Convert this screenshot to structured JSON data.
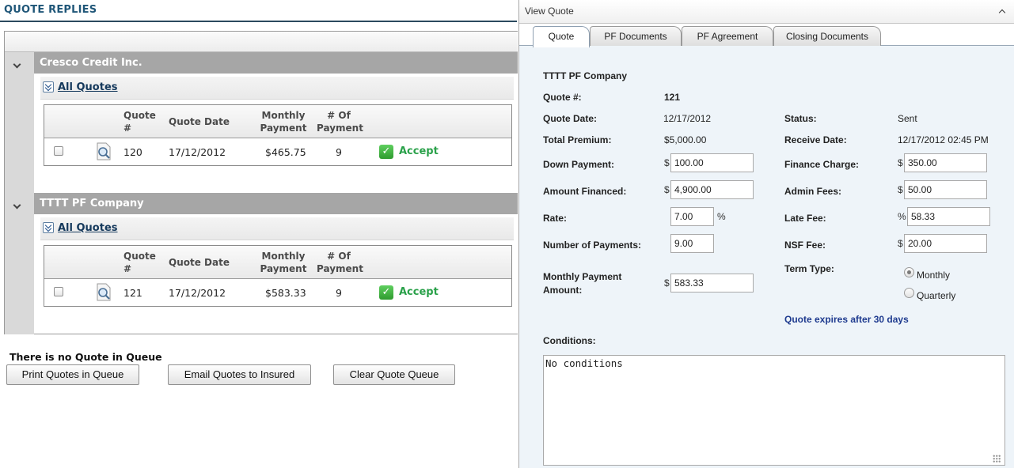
{
  "left": {
    "title": "QUOTE REPLIES",
    "companies": [
      {
        "name": "Cresco Credit Inc.",
        "all_quotes": "All Quotes",
        "headers": {
          "quote_num": "Quote #",
          "quote_date": "Quote Date",
          "monthly_payment": "Monthly Payment",
          "num_payment": "# Of Payment"
        },
        "rows": [
          {
            "quote": "120",
            "date": "17/12/2012",
            "payment": "$465.75",
            "count": "9",
            "action": "Accept"
          }
        ]
      },
      {
        "name": "TTTT PF Company",
        "all_quotes": "All Quotes",
        "headers": {
          "quote_num": "Quote #",
          "quote_date": "Quote Date",
          "monthly_payment": "Monthly Payment",
          "num_payment": "# Of Payment"
        },
        "rows": [
          {
            "quote": "121",
            "date": "17/12/2012",
            "payment": "$583.33",
            "count": "9",
            "action": "Accept"
          }
        ]
      }
    ],
    "queue_message": "There is no Quote in Queue",
    "buttons": {
      "print": "Print Quotes in Queue",
      "email": "Email Quotes to Insured",
      "clear": "Clear Quote Queue"
    }
  },
  "right": {
    "title": "View Quote",
    "tabs": [
      "Quote",
      "PF Documents",
      "PF Agreement",
      "Closing Documents"
    ],
    "company": "TTTT PF Company",
    "quote_num_label": "Quote #:",
    "quote_num": "121",
    "quote_date_label": "Quote Date:",
    "quote_date": "12/17/2012",
    "status_label": "Status:",
    "status": "Sent",
    "total_premium_label": "Total Premium:",
    "total_premium": "$5,000.00",
    "receive_date_label": "Receive Date:",
    "receive_date": "12/17/2012 02:45 PM",
    "down_payment_label": "Down Payment:",
    "down_payment": "100.00",
    "finance_charge_label": "Finance Charge:",
    "finance_charge": "350.00",
    "amount_financed_label": "Amount Financed:",
    "amount_financed": "4,900.00",
    "admin_fees_label": "Admin Fees:",
    "admin_fees": "50.00",
    "rate_label": "Rate:",
    "rate": "7.00",
    "late_fee_label": "Late Fee:",
    "late_fee": "58.33",
    "num_payments_label": "Number of Payments:",
    "num_payments": "9.00",
    "nsf_fee_label": "NSF Fee:",
    "nsf_fee": "20.00",
    "monthly_payment_label_1": "Monthly Payment",
    "monthly_payment_label_2": "Amount:",
    "monthly_payment": "583.33",
    "term_type_label": "Term Type:",
    "term_options": [
      "Monthly",
      "Quarterly"
    ],
    "term_selected": "Monthly",
    "expires": "Quote expires after 30 days",
    "conditions_label": "Conditions:",
    "conditions": "No conditions",
    "dollar": "$",
    "percent": "%"
  },
  "colors": {
    "accent_title": "#1f5678",
    "company_bar": "#a6a6a6",
    "accept_green": "#2aa14a",
    "expires_blue": "#1f3b8f",
    "panel_bg": "#eef4f9"
  }
}
